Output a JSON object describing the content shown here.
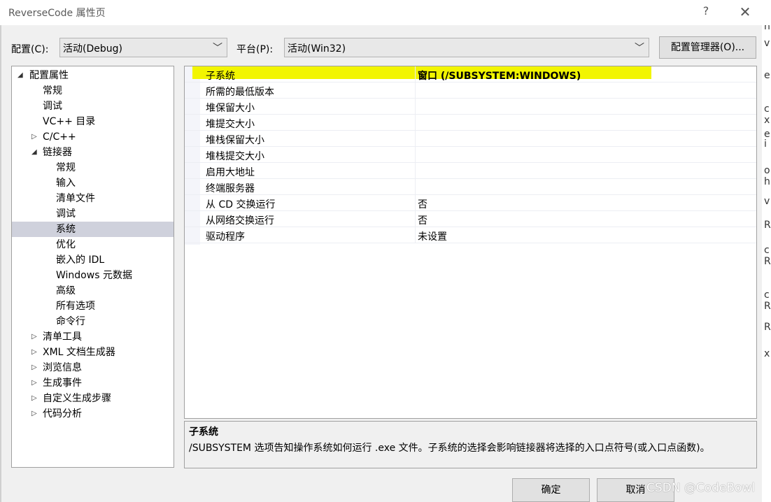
{
  "window": {
    "title": "ReverseCode 属性页",
    "help": "?",
    "close": "✕"
  },
  "toolbar": {
    "config_label": "配置(C):",
    "config_value": "活动(Debug)",
    "platform_label": "平台(P):",
    "platform_value": "活动(Win32)",
    "config_manager": "配置管理器(O)...",
    "dropdown_arrow": "﹀"
  },
  "tree": [
    {
      "label": "配置属性",
      "toggle": "◢",
      "level": 0
    },
    {
      "label": "常规",
      "toggle": "",
      "level": 1
    },
    {
      "label": "调试",
      "toggle": "",
      "level": 1
    },
    {
      "label": "VC++ 目录",
      "toggle": "",
      "level": 1
    },
    {
      "label": "C/C++",
      "toggle": "▷",
      "level": 1
    },
    {
      "label": "链接器",
      "toggle": "◢",
      "level": 1
    },
    {
      "label": "常规",
      "toggle": "",
      "level": 2
    },
    {
      "label": "输入",
      "toggle": "",
      "level": 2
    },
    {
      "label": "清单文件",
      "toggle": "",
      "level": 2
    },
    {
      "label": "调试",
      "toggle": "",
      "level": 2
    },
    {
      "label": "系统",
      "toggle": "",
      "level": 2,
      "selected": true
    },
    {
      "label": "优化",
      "toggle": "",
      "level": 2
    },
    {
      "label": "嵌入的 IDL",
      "toggle": "",
      "level": 2
    },
    {
      "label": "Windows 元数据",
      "toggle": "",
      "level": 2
    },
    {
      "label": "高级",
      "toggle": "",
      "level": 2
    },
    {
      "label": "所有选项",
      "toggle": "",
      "level": 2
    },
    {
      "label": "命令行",
      "toggle": "",
      "level": 2
    },
    {
      "label": "清单工具",
      "toggle": "▷",
      "level": 1
    },
    {
      "label": "XML 文档生成器",
      "toggle": "▷",
      "level": 1
    },
    {
      "label": "浏览信息",
      "toggle": "▷",
      "level": 1
    },
    {
      "label": "生成事件",
      "toggle": "▷",
      "level": 1
    },
    {
      "label": "自定义生成步骤",
      "toggle": "▷",
      "level": 1
    },
    {
      "label": "代码分析",
      "toggle": "▷",
      "level": 1
    }
  ],
  "properties": [
    {
      "name": "子系统",
      "value": "窗口 (/SUBSYSTEM:WINDOWS)",
      "highlight": true
    },
    {
      "name": "所需的最低版本",
      "value": ""
    },
    {
      "name": "堆保留大小",
      "value": ""
    },
    {
      "name": "堆提交大小",
      "value": ""
    },
    {
      "name": "堆栈保留大小",
      "value": ""
    },
    {
      "name": "堆栈提交大小",
      "value": ""
    },
    {
      "name": "启用大地址",
      "value": ""
    },
    {
      "name": "终端服务器",
      "value": ""
    },
    {
      "name": "从 CD 交换运行",
      "value": "否"
    },
    {
      "name": "从网络交换运行",
      "value": "否"
    },
    {
      "name": "驱动程序",
      "value": "未设置"
    }
  ],
  "description": {
    "title": "子系统",
    "text": "/SUBSYSTEM 选项告知操作系统如何运行 .exe 文件。子系统的选择会影响链接器将选择的入口点符号(或入口点函数)。"
  },
  "buttons": {
    "ok": "确定",
    "cancel": "取消"
  },
  "watermark": "CSDN @CodeBowl",
  "background_window_chars": [
    "h",
    "v",
    "e",
    "c",
    "x",
    "e",
    "i",
    "o",
    "h",
    "v",
    "R",
    "c",
    "R",
    "c",
    "R",
    "R",
    "x"
  ],
  "colors": {
    "highlight": "#f2f500",
    "selection": "#cfd1dc"
  }
}
